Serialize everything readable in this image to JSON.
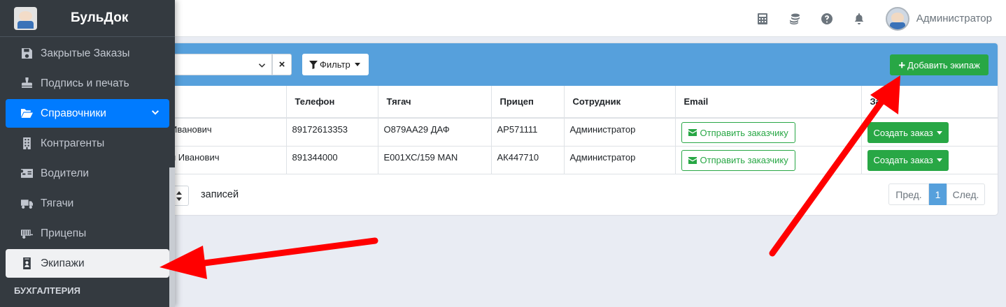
{
  "brand": {
    "name": "БульДок"
  },
  "topbar": {
    "icons": [
      "calculator-icon",
      "coins-icon",
      "question-circle-icon",
      "bell-icon"
    ],
    "user_name": "Администратор"
  },
  "sidebar": {
    "items": [
      {
        "label": "Закрытые Заказы",
        "icon": "save-icon"
      },
      {
        "label": "Подпись и печать",
        "icon": "stamp-icon"
      },
      {
        "label": "Справочники",
        "icon": "folder-open-icon"
      },
      {
        "label": "Контрагенты",
        "icon": "building-icon"
      },
      {
        "label": "Водители",
        "icon": "id-card-icon"
      },
      {
        "label": "Тягачи",
        "icon": "truck-icon"
      },
      {
        "label": "Прицепы",
        "icon": "trailer-icon"
      },
      {
        "label": "Экипажи",
        "icon": "id-badge-icon"
      }
    ],
    "section_header": "БУХГАЛТЕРИЯ"
  },
  "toolbar": {
    "clear_label": "×",
    "filter_label": "Фильтр",
    "add_label": "Добавить экипаж"
  },
  "table": {
    "columns": [
      "",
      "Телефон",
      "Тягач",
      "Прицеп",
      "Сотрудник",
      "Email",
      "Заказ"
    ],
    "rows": [
      {
        "name": "Иванович",
        "phone": "89172613353",
        "tractor": "О879АА29 ДАФ",
        "trailer": "АР571111",
        "employee": "Администратор",
        "email_action": "Отправить заказчику",
        "order_action": "Создать заказ"
      },
      {
        "name": "н Иванович",
        "phone": "891344000",
        "tractor": "Е001ХС/159 MAN",
        "trailer": "АК447710",
        "employee": "Администратор",
        "email_action": "Отправить заказчику",
        "order_action": "Создать заказ"
      }
    ]
  },
  "footer": {
    "length_label": "записей",
    "pager": {
      "prev": "Пред.",
      "current": "1",
      "next": "След."
    }
  },
  "colors": {
    "accent": "#56a0dc",
    "primary": "#007bff",
    "success": "#28a745",
    "sidebar_bg": "#343a40",
    "annotation_arrow": "#ff0000"
  }
}
